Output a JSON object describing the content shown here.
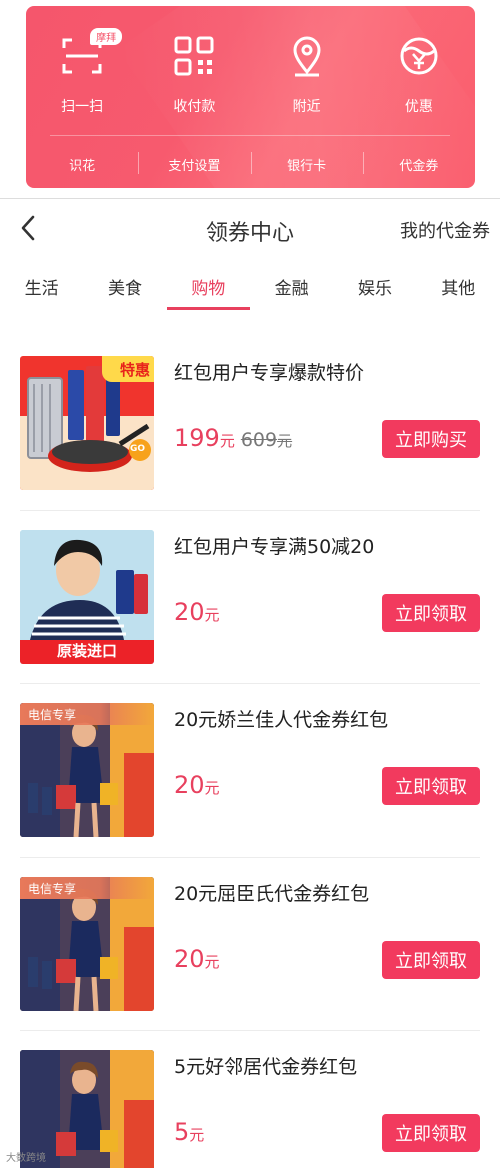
{
  "quick_actions": [
    {
      "label": "扫一扫",
      "icon": "scan-icon",
      "badge": "摩拜"
    },
    {
      "label": "收付款",
      "icon": "qr-code-icon"
    },
    {
      "label": "附近",
      "icon": "location-pin-icon"
    },
    {
      "label": "优惠",
      "icon": "yen-coupon-icon"
    }
  ],
  "sub_actions": [
    "识花",
    "支付设置",
    "银行卡",
    "代金券"
  ],
  "header": {
    "back_icon": "chevron-left-icon",
    "title": "领券中心",
    "right_link": "我的代金券"
  },
  "tabs": [
    {
      "label": "生活",
      "active": false
    },
    {
      "label": "美食",
      "active": false
    },
    {
      "label": "购物",
      "active": true
    },
    {
      "label": "金融",
      "active": false
    },
    {
      "label": "娱乐",
      "active": false
    },
    {
      "label": "其他",
      "active": false
    }
  ],
  "items": [
    {
      "title": "红包用户专享爆款特价",
      "price": "199",
      "unit": "元",
      "old_price": "609",
      "old_unit": "元",
      "button": "立即购买",
      "thumb_tag": "特惠",
      "thumb_badge": "GO"
    },
    {
      "title": "红包用户专享满50减20",
      "price": "20",
      "unit": "元",
      "button": "立即领取",
      "thumb_tag": "原装进口"
    },
    {
      "title": "20元娇兰佳人代金券红包",
      "price": "20",
      "unit": "元",
      "button": "立即领取",
      "thumb_tag": "电信专享"
    },
    {
      "title": "20元屈臣氏代金券红包",
      "price": "20",
      "unit": "元",
      "button": "立即领取",
      "thumb_tag": "电信专享"
    },
    {
      "title": "5元好邻居代金券红包",
      "price": "5",
      "unit": "元",
      "button": "立即领取"
    }
  ],
  "watermark": "大数跨境",
  "colors": {
    "accent": "#e8405e",
    "button": "#f23a5e",
    "card": "#f5566c"
  }
}
